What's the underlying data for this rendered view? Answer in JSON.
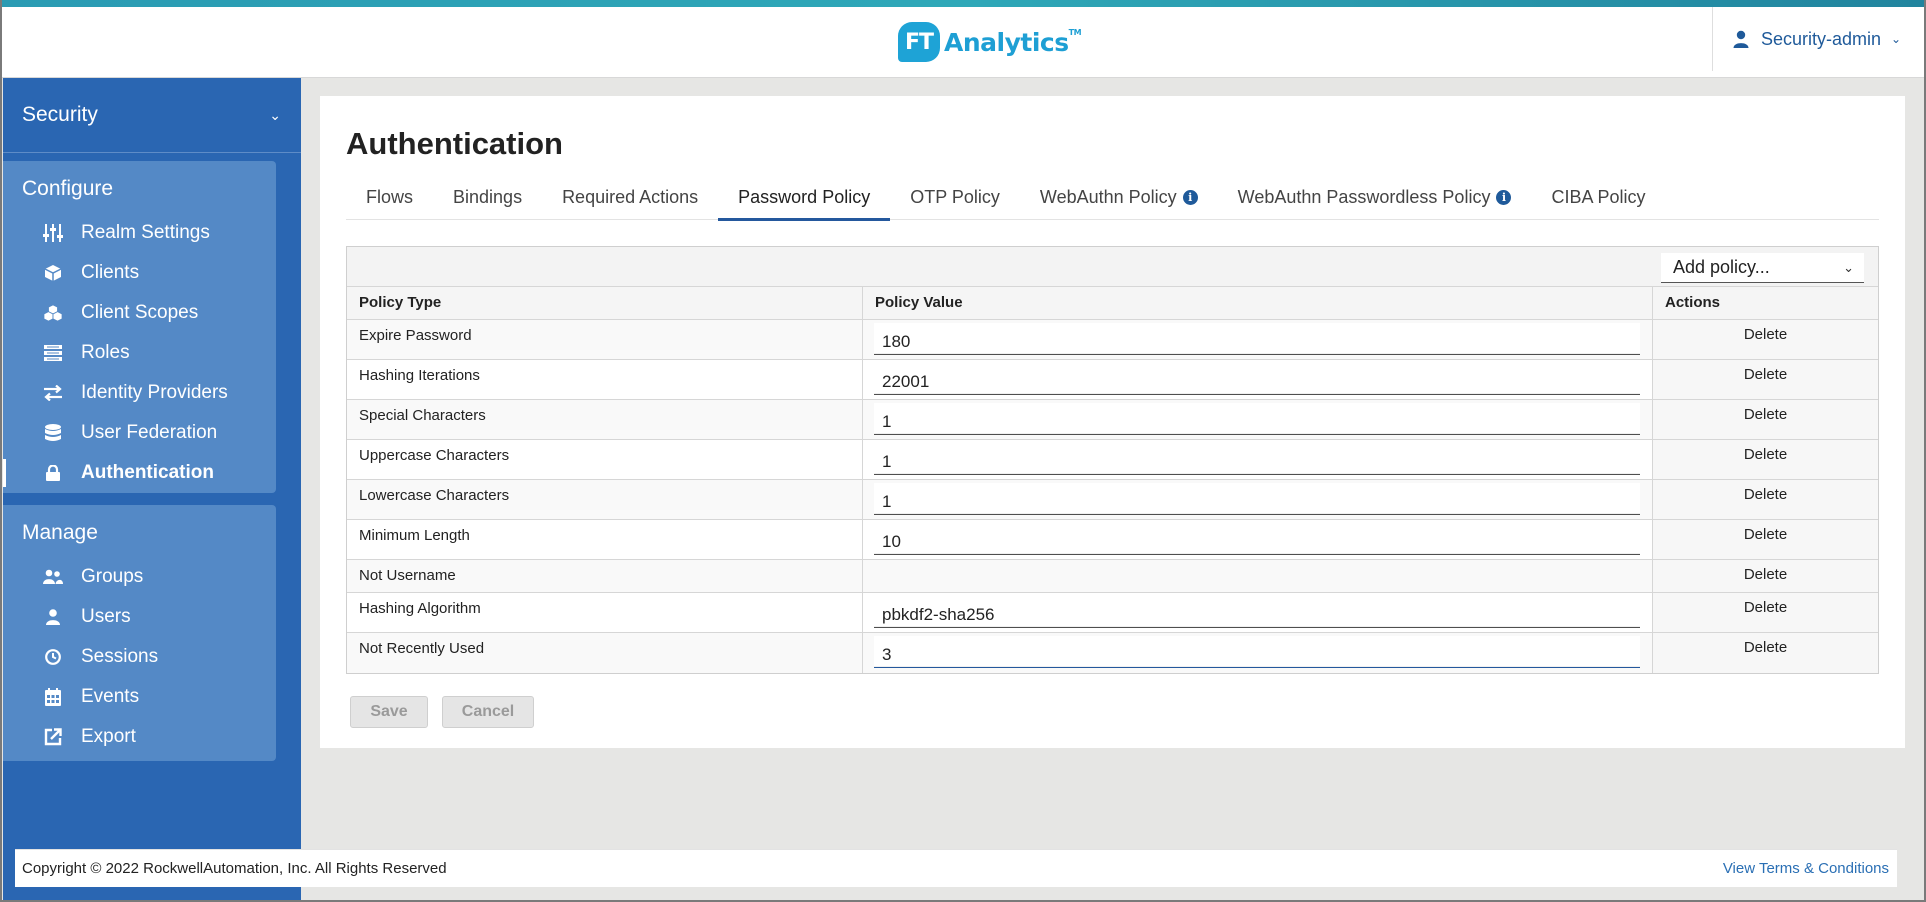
{
  "header": {
    "logo_mark": "FT",
    "logo_text": "Analytics",
    "logo_tm": "TM",
    "user_label": "Security-admin",
    "accent_color": "#2a9bb3",
    "brand_color": "#1ea3d6"
  },
  "sidebar": {
    "realm_label": "Security",
    "configure_title": "Configure",
    "configure_items": [
      {
        "label": "Realm Settings",
        "icon": "sliders-icon"
      },
      {
        "label": "Clients",
        "icon": "cube-icon"
      },
      {
        "label": "Client Scopes",
        "icon": "cubes-icon"
      },
      {
        "label": "Roles",
        "icon": "list-icon"
      },
      {
        "label": "Identity Providers",
        "icon": "exchange-icon"
      },
      {
        "label": "User Federation",
        "icon": "database-icon"
      },
      {
        "label": "Authentication",
        "icon": "lock-icon",
        "active": true
      }
    ],
    "manage_title": "Manage",
    "manage_items": [
      {
        "label": "Groups",
        "icon": "users-icon"
      },
      {
        "label": "Users",
        "icon": "user-icon"
      },
      {
        "label": "Sessions",
        "icon": "clock-icon"
      },
      {
        "label": "Events",
        "icon": "calendar-icon"
      },
      {
        "label": "Export",
        "icon": "export-icon"
      }
    ],
    "bg_color": "#2a66b2",
    "group_color": "#5489c6"
  },
  "main": {
    "title": "Authentication",
    "tabs": [
      {
        "label": "Flows"
      },
      {
        "label": "Bindings"
      },
      {
        "label": "Required Actions"
      },
      {
        "label": "Password Policy",
        "active": true
      },
      {
        "label": "OTP Policy"
      },
      {
        "label": "WebAuthn Policy",
        "info": true
      },
      {
        "label": "WebAuthn Passwordless Policy",
        "info": true
      },
      {
        "label": "CIBA Policy"
      }
    ],
    "add_policy": {
      "selected": "Add policy..."
    },
    "table": {
      "headers": {
        "type": "Policy Type",
        "value": "Policy Value",
        "actions": "Actions"
      },
      "rows": [
        {
          "type": "Expire Password",
          "value": "180",
          "action": "Delete"
        },
        {
          "type": "Hashing Iterations",
          "value": "22001",
          "action": "Delete"
        },
        {
          "type": "Special Characters",
          "value": "1",
          "action": "Delete"
        },
        {
          "type": "Uppercase Characters",
          "value": "1",
          "action": "Delete"
        },
        {
          "type": "Lowercase Characters",
          "value": "1",
          "action": "Delete"
        },
        {
          "type": "Minimum Length",
          "value": "10",
          "action": "Delete"
        },
        {
          "type": "Not Username",
          "value": null,
          "action": "Delete"
        },
        {
          "type": "Hashing Algorithm",
          "value": "pbkdf2-sha256",
          "action": "Delete"
        },
        {
          "type": "Not Recently Used",
          "value": "3",
          "action": "Delete"
        }
      ]
    },
    "buttons": {
      "save": "Save",
      "cancel": "Cancel"
    }
  },
  "footer": {
    "copyright": "Copyright © 2022 RockwellAutomation, Inc. All Rights Reserved",
    "terms": "View Terms & Conditions"
  }
}
